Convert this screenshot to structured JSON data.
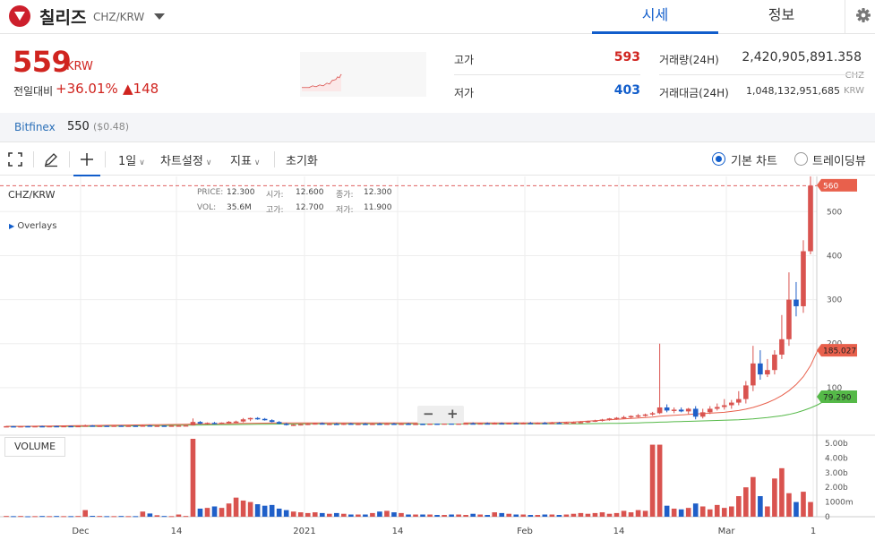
{
  "header": {
    "coin_name": "칠리즈",
    "pair": "CHZ/KRW",
    "tab_quote": "시세",
    "tab_info": "정보"
  },
  "price": {
    "current": "559",
    "unit": "KRW",
    "change_label": "전일대비",
    "change_pct": "+36.01%",
    "change_abs": "▲148"
  },
  "stats": {
    "high_label": "고가",
    "high_value": "593",
    "low_label": "저가",
    "low_value": "403",
    "volume_label": "거래량(24H)",
    "volume_value": "2,420,905,891.358",
    "volume_unit": "CHZ",
    "amount_label": "거래대금(24H)",
    "amount_value": "1,048,132,951,685",
    "amount_unit": "KRW"
  },
  "bitfinex": {
    "name": "Bitfinex",
    "price": "550",
    "usd": "($0.48)"
  },
  "toolbar": {
    "interval": "1일",
    "chart_settings": "차트설정",
    "indicators": "지표",
    "reset": "초기화",
    "basic_chart": "기본 차트",
    "tradingview": "트레이딩뷰"
  },
  "chart_overlay": {
    "symbol": "CHZ/KRW",
    "overlays": "Overlays",
    "price_label": "PRICE:",
    "price_value": "12.300",
    "open_label": "시가:",
    "open_value": "12.600",
    "close_label": "종가:",
    "close_value": "12.300",
    "vol_label": "VOL:",
    "vol_value": "35.6M",
    "high_label": "고가:",
    "high_value": "12.700",
    "low_label": "저가:",
    "low_value": "11.900",
    "volume_pane": "VOLUME",
    "zoom_out": "−",
    "zoom_in": "+"
  },
  "colors": {
    "up": "#d0241f",
    "down": "#115dcb",
    "candle_up": "#d9534f",
    "candle_down": "#1f5fc8",
    "ma_short": "#e8604c",
    "ma_long": "#55b948"
  },
  "chart_data": {
    "type": "candlestick",
    "x_ticks": [
      "Dec",
      "14",
      "2021",
      "14",
      "Feb",
      "14",
      "Mar",
      "1"
    ],
    "y_ticks": [
      "500",
      "400",
      "300",
      "200",
      "100"
    ],
    "volume_ticks": [
      "5.00b",
      "4.00b",
      "3.00b",
      "2.00b",
      "1000m",
      "0"
    ],
    "current_price_tag": "560",
    "ma_short_tag": "185.027",
    "ma_long_tag": "79.290",
    "ylim": [
      0,
      580
    ],
    "volume_ylim": [
      0,
      5.3
    ],
    "candles": [
      {
        "o": 12,
        "h": 13,
        "l": 11,
        "c": 12.5,
        "v": 0.05
      },
      {
        "o": 12.5,
        "h": 13,
        "l": 12,
        "c": 12.3,
        "v": 0.04
      },
      {
        "o": 12.3,
        "h": 13,
        "l": 11.5,
        "c": 12.6,
        "v": 0.05
      },
      {
        "o": 12.6,
        "h": 13.2,
        "l": 12,
        "c": 12.4,
        "v": 0.03
      },
      {
        "o": 12.4,
        "h": 13,
        "l": 12,
        "c": 12.7,
        "v": 0.04
      },
      {
        "o": 12.7,
        "h": 13.5,
        "l": 12.2,
        "c": 12.5,
        "v": 0.05
      },
      {
        "o": 12.5,
        "h": 13,
        "l": 12,
        "c": 12.8,
        "v": 0.04
      },
      {
        "o": 12.8,
        "h": 13.4,
        "l": 12.3,
        "c": 12.6,
        "v": 0.05
      },
      {
        "o": 12.6,
        "h": 13,
        "l": 12.1,
        "c": 12.9,
        "v": 0.04
      },
      {
        "o": 12.9,
        "h": 13.5,
        "l": 12.5,
        "c": 12.7,
        "v": 0.04
      },
      {
        "o": 12.7,
        "h": 13.2,
        "l": 12.2,
        "c": 13.0,
        "v": 0.05
      },
      {
        "o": 13,
        "h": 16,
        "l": 12.5,
        "c": 14,
        "v": 0.45
      },
      {
        "o": 14,
        "h": 15,
        "l": 13,
        "c": 13.4,
        "v": 0.06
      },
      {
        "o": 13.4,
        "h": 14,
        "l": 12.8,
        "c": 13.6,
        "v": 0.05
      },
      {
        "o": 13.6,
        "h": 14,
        "l": 13,
        "c": 13.2,
        "v": 0.04
      },
      {
        "o": 13.2,
        "h": 14,
        "l": 12.8,
        "c": 13.8,
        "v": 0.04
      },
      {
        "o": 13.8,
        "h": 14.5,
        "l": 13,
        "c": 13.3,
        "v": 0.05
      },
      {
        "o": 13.3,
        "h": 14,
        "l": 12.9,
        "c": 13.7,
        "v": 0.04
      },
      {
        "o": 13.7,
        "h": 14,
        "l": 13,
        "c": 13.5,
        "v": 0.04
      },
      {
        "o": 13.5,
        "h": 15,
        "l": 13,
        "c": 14.2,
        "v": 0.35
      },
      {
        "o": 14.2,
        "h": 15,
        "l": 13.5,
        "c": 13.6,
        "v": 0.22
      },
      {
        "o": 13.6,
        "h": 14,
        "l": 13,
        "c": 13.8,
        "v": 0.1
      },
      {
        "o": 13.8,
        "h": 14.2,
        "l": 13.2,
        "c": 13.4,
        "v": 0.05
      },
      {
        "o": 13.4,
        "h": 14,
        "l": 13,
        "c": 13.9,
        "v": 0.04
      },
      {
        "o": 13.9,
        "h": 14.5,
        "l": 13.4,
        "c": 14.1,
        "v": 0.15
      },
      {
        "o": 14.1,
        "h": 14.8,
        "l": 13.8,
        "c": 14.5,
        "v": 0.05
      },
      {
        "o": 14.5,
        "h": 30,
        "l": 14,
        "c": 22,
        "v": 5.3
      },
      {
        "o": 22,
        "h": 24,
        "l": 17,
        "c": 18,
        "v": 0.55
      },
      {
        "o": 18,
        "h": 21,
        "l": 16,
        "c": 20,
        "v": 0.6
      },
      {
        "o": 20,
        "h": 22,
        "l": 17,
        "c": 18.5,
        "v": 0.7
      },
      {
        "o": 18.5,
        "h": 21,
        "l": 17,
        "c": 20.5,
        "v": 0.6
      },
      {
        "o": 20.5,
        "h": 24,
        "l": 19,
        "c": 22.5,
        "v": 0.9
      },
      {
        "o": 22.5,
        "h": 25,
        "l": 20,
        "c": 23,
        "v": 1.3
      },
      {
        "o": 23,
        "h": 31,
        "l": 21,
        "c": 28,
        "v": 1.1
      },
      {
        "o": 28,
        "h": 32,
        "l": 24,
        "c": 31,
        "v": 1.0
      },
      {
        "o": 31,
        "h": 33,
        "l": 27,
        "c": 29,
        "v": 0.85
      },
      {
        "o": 29,
        "h": 31,
        "l": 25,
        "c": 26,
        "v": 0.75
      },
      {
        "o": 26,
        "h": 28,
        "l": 21,
        "c": 22,
        "v": 0.8
      },
      {
        "o": 22,
        "h": 24,
        "l": 17,
        "c": 18,
        "v": 0.55
      },
      {
        "o": 18,
        "h": 20,
        "l": 14,
        "c": 15,
        "v": 0.45
      },
      {
        "o": 15,
        "h": 17,
        "l": 13,
        "c": 16,
        "v": 0.35
      },
      {
        "o": 16,
        "h": 18,
        "l": 14,
        "c": 17,
        "v": 0.3
      },
      {
        "o": 17,
        "h": 19,
        "l": 15,
        "c": 18,
        "v": 0.25
      },
      {
        "o": 18,
        "h": 20,
        "l": 16,
        "c": 19,
        "v": 0.3
      },
      {
        "o": 19,
        "h": 21,
        "l": 16,
        "c": 17,
        "v": 0.25
      },
      {
        "o": 17,
        "h": 19,
        "l": 15,
        "c": 18,
        "v": 0.2
      },
      {
        "o": 18,
        "h": 20,
        "l": 16,
        "c": 17.5,
        "v": 0.25
      },
      {
        "o": 17.5,
        "h": 19,
        "l": 15,
        "c": 18.5,
        "v": 0.2
      },
      {
        "o": 18.5,
        "h": 20,
        "l": 16,
        "c": 17,
        "v": 0.15
      },
      {
        "o": 17,
        "h": 19,
        "l": 15,
        "c": 18,
        "v": 0.15
      },
      {
        "o": 18,
        "h": 20,
        "l": 16,
        "c": 17.2,
        "v": 0.15
      },
      {
        "o": 17.2,
        "h": 19,
        "l": 15.5,
        "c": 18.1,
        "v": 0.25
      },
      {
        "o": 18.1,
        "h": 20,
        "l": 16,
        "c": 17.4,
        "v": 0.35
      },
      {
        "o": 17.4,
        "h": 19,
        "l": 15.5,
        "c": 18.3,
        "v": 0.4
      },
      {
        "o": 18.3,
        "h": 20,
        "l": 16.5,
        "c": 17.8,
        "v": 0.3
      },
      {
        "o": 17.8,
        "h": 19,
        "l": 16,
        "c": 18.2,
        "v": 0.25
      },
      {
        "o": 18.2,
        "h": 20,
        "l": 16,
        "c": 17.5,
        "v": 0.15
      },
      {
        "o": 17.5,
        "h": 19,
        "l": 15.5,
        "c": 18.0,
        "v": 0.15
      },
      {
        "o": 18.0,
        "h": 20,
        "l": 16,
        "c": 17.6,
        "v": 0.15
      },
      {
        "o": 17.6,
        "h": 19,
        "l": 15.8,
        "c": 18.4,
        "v": 0.15
      },
      {
        "o": 18.4,
        "h": 20,
        "l": 16.5,
        "c": 18,
        "v": 0.12
      },
      {
        "o": 18,
        "h": 20,
        "l": 16,
        "c": 18.8,
        "v": 0.12
      },
      {
        "o": 18.8,
        "h": 21,
        "l": 17,
        "c": 18.2,
        "v": 0.15
      },
      {
        "o": 18.2,
        "h": 20,
        "l": 16.5,
        "c": 18.6,
        "v": 0.15
      },
      {
        "o": 18.6,
        "h": 20,
        "l": 17,
        "c": 18.9,
        "v": 0.12
      },
      {
        "o": 18.9,
        "h": 21,
        "l": 17,
        "c": 18.5,
        "v": 0.2
      },
      {
        "o": 18.5,
        "h": 20,
        "l": 17,
        "c": 19,
        "v": 0.15
      },
      {
        "o": 19,
        "h": 21,
        "l": 17.5,
        "c": 18.7,
        "v": 0.12
      },
      {
        "o": 18.7,
        "h": 21,
        "l": 17,
        "c": 19.2,
        "v": 0.3
      },
      {
        "o": 19.2,
        "h": 21,
        "l": 17.5,
        "c": 18.8,
        "v": 0.25
      },
      {
        "o": 18.8,
        "h": 20.5,
        "l": 17.2,
        "c": 19.4,
        "v": 0.2
      },
      {
        "o": 19.4,
        "h": 21,
        "l": 17.8,
        "c": 19.0,
        "v": 0.15
      },
      {
        "o": 19.0,
        "h": 21,
        "l": 17.5,
        "c": 19.6,
        "v": 0.15
      },
      {
        "o": 19.6,
        "h": 22,
        "l": 18,
        "c": 19.2,
        "v": 0.12
      },
      {
        "o": 19.2,
        "h": 21,
        "l": 17.5,
        "c": 19.8,
        "v": 0.12
      },
      {
        "o": 19.8,
        "h": 22,
        "l": 18,
        "c": 19.5,
        "v": 0.15
      },
      {
        "o": 19.5,
        "h": 22,
        "l": 18,
        "c": 20,
        "v": 0.15
      },
      {
        "o": 20,
        "h": 22,
        "l": 18.5,
        "c": 19.6,
        "v": 0.12
      },
      {
        "o": 19.6,
        "h": 22,
        "l": 18,
        "c": 20.2,
        "v": 0.15
      },
      {
        "o": 20.2,
        "h": 23,
        "l": 18.5,
        "c": 21,
        "v": 0.2
      },
      {
        "o": 21,
        "h": 24,
        "l": 19,
        "c": 22,
        "v": 0.25
      },
      {
        "o": 22,
        "h": 25,
        "l": 20,
        "c": 24,
        "v": 0.2
      },
      {
        "o": 24,
        "h": 27,
        "l": 22,
        "c": 25.5,
        "v": 0.25
      },
      {
        "o": 25.5,
        "h": 29,
        "l": 23,
        "c": 27.5,
        "v": 0.3
      },
      {
        "o": 27.5,
        "h": 31,
        "l": 25,
        "c": 30,
        "v": 0.2
      },
      {
        "o": 30,
        "h": 33,
        "l": 27,
        "c": 31.5,
        "v": 0.25
      },
      {
        "o": 31.5,
        "h": 36,
        "l": 29,
        "c": 33,
        "v": 0.4
      },
      {
        "o": 33,
        "h": 37,
        "l": 30,
        "c": 35.5,
        "v": 0.3
      },
      {
        "o": 35.5,
        "h": 40,
        "l": 32,
        "c": 37,
        "v": 0.45
      },
      {
        "o": 37,
        "h": 41,
        "l": 34,
        "c": 39,
        "v": 0.4
      },
      {
        "o": 39,
        "h": 45,
        "l": 36,
        "c": 42,
        "v": 4.9
      },
      {
        "o": 42,
        "h": 200,
        "l": 40,
        "c": 55,
        "v": 4.9
      },
      {
        "o": 55,
        "h": 62,
        "l": 44,
        "c": 48,
        "v": 0.75
      },
      {
        "o": 48,
        "h": 55,
        "l": 42,
        "c": 50,
        "v": 0.55
      },
      {
        "o": 50,
        "h": 55,
        "l": 44,
        "c": 46,
        "v": 0.5
      },
      {
        "o": 46,
        "h": 54,
        "l": 40,
        "c": 52,
        "v": 0.6
      },
      {
        "o": 52,
        "h": 58,
        "l": 28,
        "c": 34,
        "v": 0.9
      },
      {
        "o": 34,
        "h": 52,
        "l": 30,
        "c": 44,
        "v": 0.7
      },
      {
        "o": 44,
        "h": 58,
        "l": 40,
        "c": 52,
        "v": 0.5
      },
      {
        "o": 52,
        "h": 64,
        "l": 48,
        "c": 56,
        "v": 0.8
      },
      {
        "o": 56,
        "h": 74,
        "l": 50,
        "c": 60,
        "v": 0.6
      },
      {
        "o": 60,
        "h": 72,
        "l": 52,
        "c": 66,
        "v": 0.7
      },
      {
        "o": 66,
        "h": 92,
        "l": 60,
        "c": 74,
        "v": 1.4
      },
      {
        "o": 74,
        "h": 115,
        "l": 64,
        "c": 105,
        "v": 2.0
      },
      {
        "o": 105,
        "h": 195,
        "l": 92,
        "c": 155,
        "v": 2.7
      },
      {
        "o": 155,
        "h": 185,
        "l": 118,
        "c": 130,
        "v": 1.4
      },
      {
        "o": 130,
        "h": 165,
        "l": 124,
        "c": 140,
        "v": 0.7
      },
      {
        "o": 140,
        "h": 185,
        "l": 130,
        "c": 175,
        "v": 2.6
      },
      {
        "o": 175,
        "h": 265,
        "l": 165,
        "c": 210,
        "v": 3.3
      },
      {
        "o": 210,
        "h": 362,
        "l": 195,
        "c": 300,
        "v": 1.6
      },
      {
        "o": 300,
        "h": 340,
        "l": 262,
        "c": 285,
        "v": 1.0
      },
      {
        "o": 285,
        "h": 435,
        "l": 270,
        "c": 410,
        "v": 1.7
      },
      {
        "o": 410,
        "h": 580,
        "l": 403,
        "c": 559,
        "v": 1.0
      }
    ],
    "ma_short": [
      12,
      12,
      12,
      12.2,
      12.4,
      12.6,
      12.8,
      13,
      13.2,
      13.4,
      13.6,
      13.8,
      14,
      14.2,
      14.4,
      14.6,
      14.8,
      15,
      15.2,
      15.4,
      15.6,
      15.8,
      16,
      16.2,
      16.5,
      16.8,
      17.2,
      17.5,
      17.8,
      18,
      18.2,
      18.4,
      18.6,
      18.8,
      19,
      19.2,
      19.4,
      19.6,
      19.8,
      20,
      20,
      20,
      20,
      20,
      20,
      20,
      20,
      20,
      20,
      20,
      20,
      20,
      20,
      20,
      20,
      20,
      20,
      20,
      20,
      20,
      20,
      20,
      20,
      20,
      20,
      20,
      20,
      20,
      20,
      20,
      20,
      20,
      20,
      20,
      20,
      20,
      20.5,
      21,
      21.5,
      22,
      23,
      24,
      25,
      26,
      27,
      28,
      29,
      30,
      31,
      32,
      33,
      35,
      36,
      37,
      38,
      39,
      40,
      41,
      42,
      43,
      44,
      46,
      48,
      51,
      55,
      60,
      66,
      73,
      82,
      93,
      107,
      125,
      150,
      185.027
    ],
    "ma_long": [
      12,
      12,
      12,
      12,
      12,
      12,
      12,
      12,
      12,
      12,
      12,
      12,
      12,
      12.2,
      12.4,
      12.6,
      12.8,
      13,
      13.2,
      13.4,
      13.6,
      13.8,
      14,
      14.2,
      14.4,
      14.6,
      14.8,
      15,
      15.2,
      15.4,
      15.6,
      15.8,
      16,
      16.2,
      16.4,
      16.6,
      16.8,
      17,
      17.2,
      17.4,
      17.6,
      17.8,
      18,
      18,
      18,
      18,
      18,
      18,
      18,
      18,
      18,
      18,
      18,
      18,
      18,
      18,
      18,
      18,
      18,
      18,
      18,
      18,
      18,
      18,
      18,
      18,
      18,
      18,
      18,
      18,
      18,
      18,
      18,
      18,
      18,
      18,
      18,
      18,
      18,
      18,
      18,
      18.2,
      18.4,
      18.6,
      18.8,
      19,
      19.2,
      19.5,
      20,
      20.5,
      21,
      21.5,
      22,
      22.5,
      23,
      23.5,
      24,
      24.5,
      25,
      25.5,
      26,
      26.5,
      27,
      28,
      29,
      30.5,
      32,
      34,
      36,
      39,
      43,
      48,
      54,
      61,
      70,
      79.29
    ]
  }
}
